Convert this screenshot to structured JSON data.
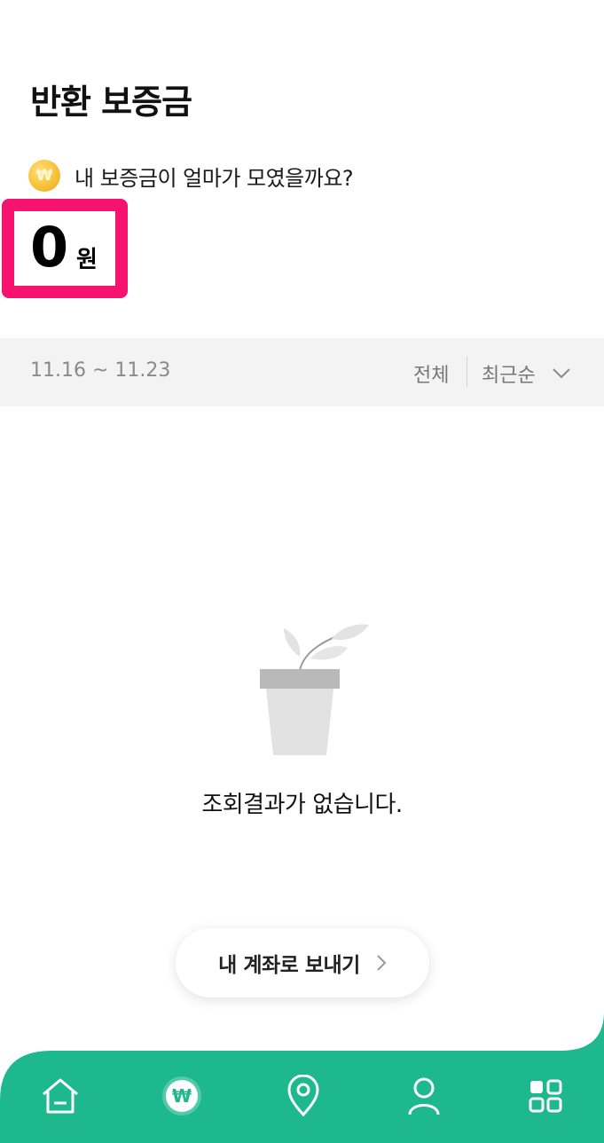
{
  "header": {
    "title": "반환 보증금"
  },
  "summary": {
    "coin_symbol": "₩",
    "question": "내 보증금이 얼마가 모였을까요?",
    "amount": "0",
    "unit": "원",
    "highlight_color": "#f5136f"
  },
  "filter": {
    "date_range": "11.16 ~ 11.23",
    "type_label": "전체",
    "sort_label": "최근순"
  },
  "empty_state": {
    "message": "조회결과가 없습니다.",
    "icon": "plant-pot-icon"
  },
  "actions": {
    "send_to_account": "내 계좌로 보내기"
  },
  "nav": {
    "accent_color": "#1db88e",
    "items": [
      {
        "icon": "home-icon",
        "active": false
      },
      {
        "icon": "won-coin-icon",
        "active": true
      },
      {
        "icon": "location-pin-icon",
        "active": false
      },
      {
        "icon": "person-icon",
        "active": false
      },
      {
        "icon": "grid-menu-icon",
        "active": false
      }
    ]
  }
}
